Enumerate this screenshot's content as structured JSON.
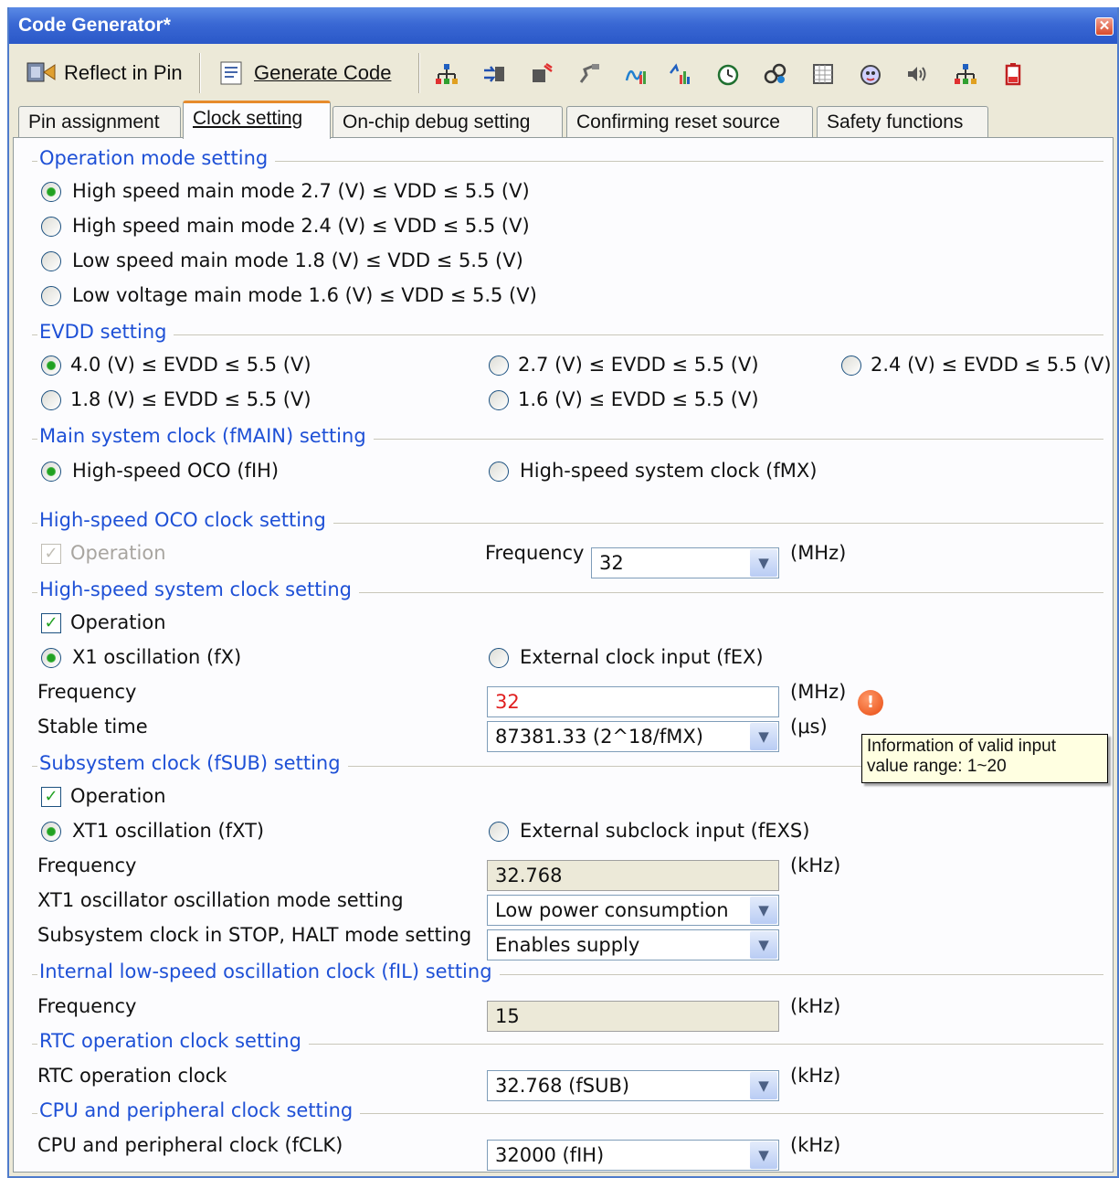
{
  "window": {
    "title": "Code Generator*"
  },
  "toolbar": {
    "reflect_label": "Reflect in Pin",
    "generate_label": "Generate Code",
    "icons": [
      "port-icon",
      "interrupt-icon",
      "serial-icon",
      "adc-icon",
      "dac-icon",
      "comparator-icon",
      "timer-icon",
      "watchdog-icon",
      "rtc-icon",
      "interval-timer-icon",
      "clock-output-icon",
      "buzzer-icon",
      "dma-icon",
      "battery-icon"
    ]
  },
  "tabs": [
    "Pin assignment",
    "Clock setting",
    "On-chip debug setting",
    "Confirming reset source",
    "Safety functions"
  ],
  "operation_mode": {
    "title": "Operation mode setting",
    "options": [
      "High speed main mode 2.7 (V) ≤ VDD ≤ 5.5 (V)",
      "High speed main mode 2.4 (V) ≤ VDD ≤ 5.5 (V)",
      "Low speed main mode 1.8 (V) ≤ VDD ≤ 5.5 (V)",
      "Low voltage main mode 1.6 (V) ≤ VDD ≤ 5.5 (V)"
    ]
  },
  "evdd": {
    "title": "EVDD setting",
    "options": [
      "4.0 (V) ≤ EVDD ≤ 5.5 (V)",
      "2.7 (V) ≤ EVDD ≤ 5.5 (V)",
      "2.4 (V) ≤ EVDD ≤ 5.5 (V)",
      "1.8 (V) ≤ EVDD ≤ 5.5 (V)",
      "1.6 (V) ≤ EVDD ≤ 5.5 (V)"
    ]
  },
  "main_clock": {
    "title": "Main system clock (fMAIN) setting",
    "options": [
      "High-speed OCO (fIH)",
      "High-speed system clock (fMX)"
    ]
  },
  "oco": {
    "title": "High-speed OCO clock setting",
    "operation": "Operation",
    "freq_label": "Frequency",
    "freq_value": "32",
    "unit": "(MHz)"
  },
  "hs_system": {
    "title": "High-speed system clock setting",
    "operation": "Operation",
    "options": [
      "X1 oscillation (fX)",
      "External clock input (fEX)"
    ],
    "freq_label": "Frequency",
    "freq_value": "32",
    "freq_unit": "(MHz)",
    "stable_label": "Stable time",
    "stable_value": "87381.33 (2^18/fMX)",
    "stable_unit": "(μs)"
  },
  "tooltip": {
    "line1": "Information of valid input",
    "line2": "value range: 1~20"
  },
  "subsystem": {
    "title": "Subsystem clock (fSUB) setting",
    "operation": "Operation",
    "options": [
      "XT1 oscillation (fXT)",
      "External subclock input (fEXS)"
    ],
    "freq_label": "Frequency",
    "freq_value": "32.768",
    "freq_unit": "(kHz)",
    "mode_label": "XT1 oscillator oscillation mode setting",
    "mode_value": "Low power consumption",
    "stop_label": "Subsystem clock in STOP, HALT mode setting",
    "stop_value": "Enables supply"
  },
  "internal_low": {
    "title": "Internal low-speed oscillation clock (fIL) setting",
    "freq_label": "Frequency",
    "freq_value": "15",
    "unit": "(kHz)"
  },
  "rtc": {
    "title": "RTC operation clock setting",
    "label": "RTC operation clock",
    "value": "32.768 (fSUB)",
    "unit": "(kHz)"
  },
  "cpu": {
    "title": "CPU and peripheral clock setting",
    "label": "CPU and peripheral clock (fCLK)",
    "value": "32000 (fIH)",
    "unit": "(kHz)"
  }
}
